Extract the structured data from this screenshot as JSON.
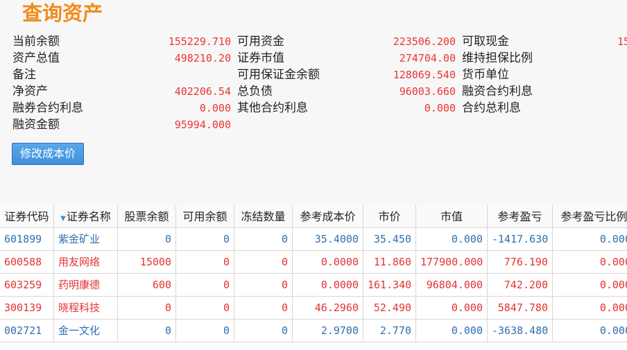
{
  "page_title": "查询资产",
  "summary": {
    "col1": [
      {
        "label": "当前余额",
        "value": "155229.710"
      },
      {
        "label": "资产总值",
        "value": "498210.20"
      },
      {
        "label": "备注",
        "value": ""
      },
      {
        "label": "净资产",
        "value": "402206.54"
      },
      {
        "label": "融券合约利息",
        "value": "0.000"
      },
      {
        "label": "融资金额",
        "value": "95994.000"
      }
    ],
    "col2": [
      {
        "label": "可用资金",
        "value": "223506.200"
      },
      {
        "label": "证券市值",
        "value": "274704.00"
      },
      {
        "label": "可用保证金余额",
        "value": "128069.540"
      },
      {
        "label": "总负债",
        "value": "96003.660"
      },
      {
        "label": "其他合约利息",
        "value": "0.000"
      }
    ],
    "col3": [
      {
        "label": "可取现金",
        "value": "15"
      },
      {
        "label": "维持担保比例",
        "value": ""
      },
      {
        "label": "货币单位",
        "value": ""
      },
      {
        "label": "融资合约利息",
        "value": ""
      },
      {
        "label": "合约总利息",
        "value": ""
      }
    ]
  },
  "buttons": {
    "modify_cost": "修改成本价"
  },
  "table": {
    "sort_indicator": "▼",
    "headers": [
      "证券代码",
      "证券名称",
      "股票余额",
      "可用余额",
      "冻结数量",
      "参考成本价",
      "市价",
      "市值",
      "参考盈亏",
      "参考盈亏比例"
    ],
    "rows": [
      {
        "color": "#2f6fb0",
        "cells": [
          "601899",
          "紫金矿业",
          "0",
          "0",
          "0",
          "35.4000",
          "35.450",
          "0.000",
          "-1417.630",
          "0.000"
        ]
      },
      {
        "color": "#e33333",
        "cells": [
          "600588",
          "用友网络",
          "15000",
          "0",
          "0",
          "0.0000",
          "11.860",
          "177900.000",
          "776.190",
          "0.000"
        ]
      },
      {
        "color": "#e33333",
        "cells": [
          "603259",
          "药明康德",
          "600",
          "0",
          "0",
          "0.0000",
          "161.340",
          "96804.000",
          "742.200",
          "0.000"
        ]
      },
      {
        "color": "#e33333",
        "cells": [
          "300139",
          "晓程科技",
          "0",
          "0",
          "0",
          "46.2960",
          "52.490",
          "0.000",
          "5847.780",
          "0.000"
        ]
      },
      {
        "color": "#2f6fb0",
        "cells": [
          "002721",
          "金一文化",
          "0",
          "0",
          "0",
          "2.9700",
          "2.770",
          "0.000",
          "-3638.480",
          "0.000"
        ]
      }
    ]
  }
}
